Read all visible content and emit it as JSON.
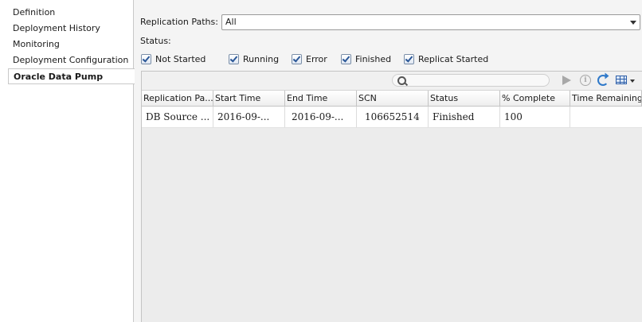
{
  "nav": {
    "items": [
      {
        "label": "Definition"
      },
      {
        "label": "Deployment History"
      },
      {
        "label": "Monitoring"
      },
      {
        "label": "Deployment Configuration"
      },
      {
        "label": "Oracle Data Pump"
      }
    ],
    "selected": "Oracle Data Pump"
  },
  "filters": {
    "replication_paths_label": "Replication Paths:",
    "replication_paths_value": "All",
    "status_label": "Status:",
    "checkboxes": [
      {
        "label": "Not Started",
        "checked": true
      },
      {
        "label": "Running",
        "checked": true
      },
      {
        "label": "Error",
        "checked": true
      },
      {
        "label": "Finished",
        "checked": true
      },
      {
        "label": "Replicat Started",
        "checked": true
      }
    ]
  },
  "toolbar": {
    "search_value": "",
    "icons": [
      "search-icon",
      "play-icon",
      "info-icon",
      "refresh-icon",
      "grid-icon"
    ]
  },
  "table": {
    "columns": [
      "Replication Pa...",
      "Start Time",
      "End Time",
      "SCN",
      "Status",
      "% Complete",
      "Time Remaining"
    ],
    "rows": [
      {
        "replication_path": "DB Source ...",
        "start_time": "2016-09-...",
        "end_time": "2016-09-...",
        "scn": "106652514",
        "status": "Finished",
        "percent_complete": "100",
        "time_remaining": ""
      }
    ]
  },
  "colors": {
    "accent": "#2f79c9",
    "check": "#2b5797",
    "background": "#f4f4f4"
  }
}
